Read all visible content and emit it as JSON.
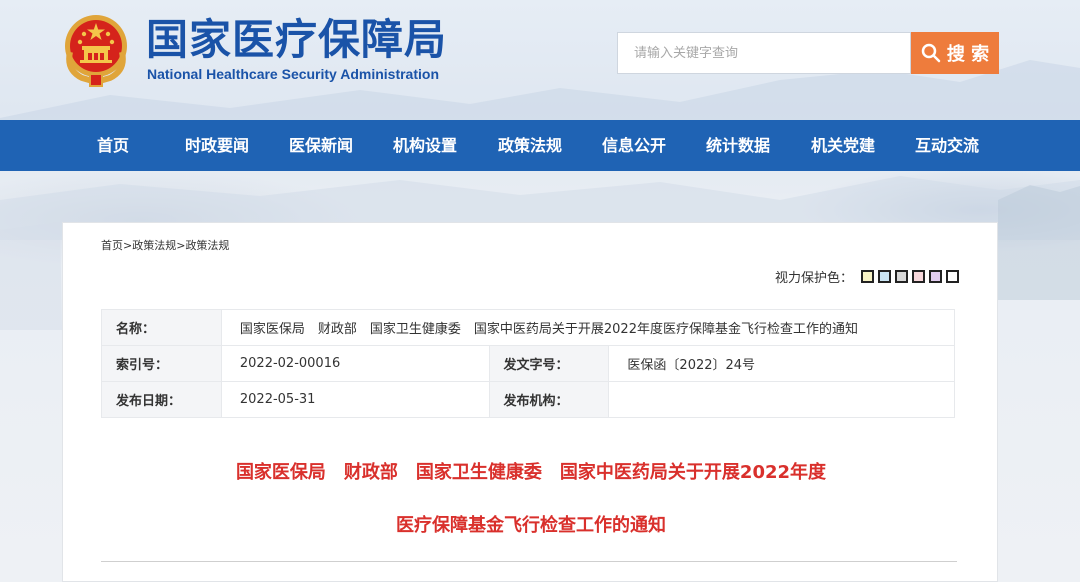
{
  "header": {
    "site_name": "国家医疗保障局",
    "site_name_en": "National Healthcare Security Administration"
  },
  "search": {
    "placeholder": "请输入关键字查询",
    "button_label": "搜 索"
  },
  "nav": {
    "items": [
      {
        "label": "首页"
      },
      {
        "label": "时政要闻"
      },
      {
        "label": "医保新闻"
      },
      {
        "label": "机构设置"
      },
      {
        "label": "政策法规"
      },
      {
        "label": "信息公开"
      },
      {
        "label": "统计数据"
      },
      {
        "label": "机关党建"
      },
      {
        "label": "互动交流"
      }
    ]
  },
  "breadcrumb": {
    "items": [
      "首页",
      "政策法规",
      "政策法规"
    ],
    "separator": ">"
  },
  "vision_protection": {
    "label": "视力保护色：",
    "colors": [
      "#f7f3c5",
      "#cbe5f4",
      "#d8d8d8",
      "#f8d8dc",
      "#e2cdf0",
      "#ffffff"
    ]
  },
  "meta_table": {
    "name_label": "名称：",
    "name_value": "国家医保局　财政部　国家卫生健康委　国家中医药局关于开展2022年度医疗保障基金飞行检查工作的通知",
    "index_label": "索引号：",
    "index_value": "2022-02-00016",
    "doc_no_label": "发文字号：",
    "doc_no_value": "医保函〔2022〕24号",
    "date_label": "发布日期：",
    "date_value": "2022-05-31",
    "agency_label": "发布机构：",
    "agency_value": ""
  },
  "document": {
    "title_line1": "国家医保局　财政部　国家卫生健康委　国家中医药局关于开展2022年度",
    "title_line2": "医疗保障基金飞行检查工作的通知"
  }
}
